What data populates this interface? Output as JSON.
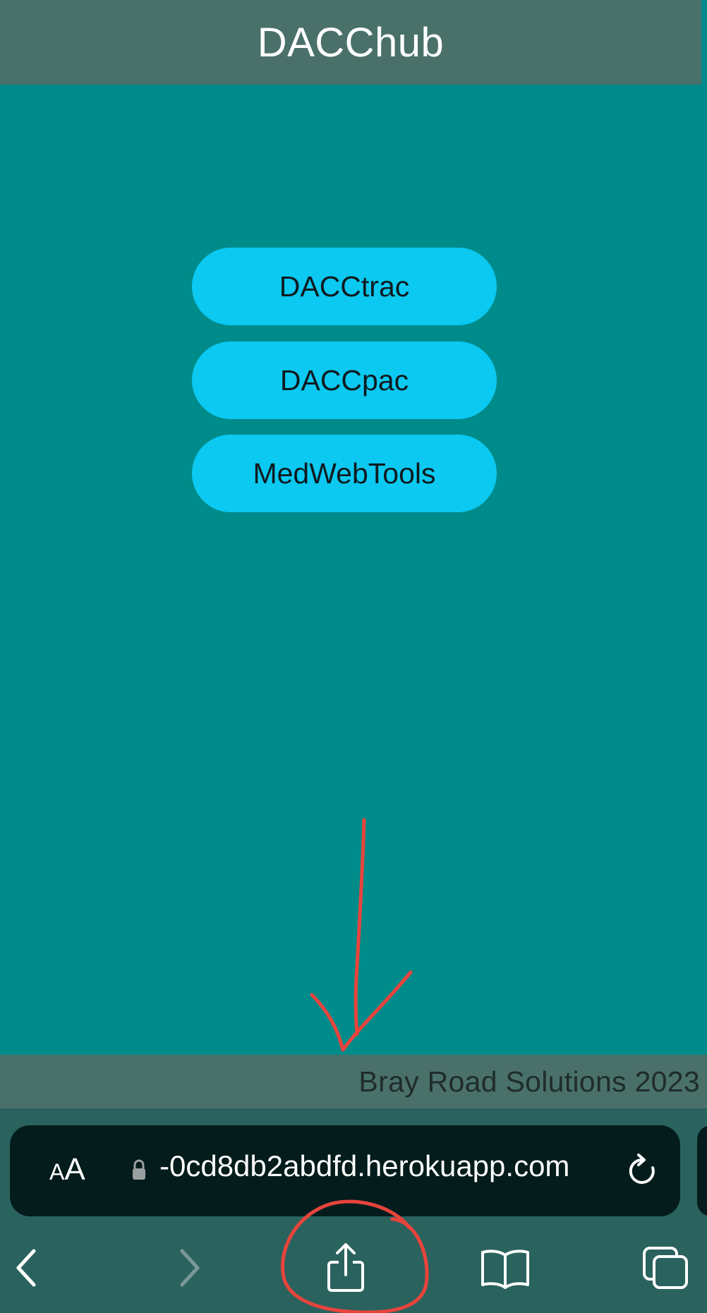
{
  "header": {
    "title": "DACChub"
  },
  "buttons": [
    {
      "label": "DACCtrac"
    },
    {
      "label": "DACCpac"
    },
    {
      "label": "MedWebTools"
    }
  ],
  "footer": {
    "text": "Bray Road Solutions 2023"
  },
  "browser": {
    "text_size_label_small": "A",
    "text_size_label_large": "A",
    "url": "-0cd8db2abdfd.herokuapp.com"
  },
  "toolbar": {
    "icons": [
      "back-icon",
      "forward-icon",
      "share-icon",
      "bookmarks-icon",
      "tabs-icon"
    ]
  },
  "colors": {
    "page_background": "#008b8b",
    "header_background": "#4a706a",
    "button_background": "#0bc9f1",
    "annotation": "#e8443c",
    "browser_chrome": "#2a625e",
    "url_bar": "#041c1c"
  }
}
